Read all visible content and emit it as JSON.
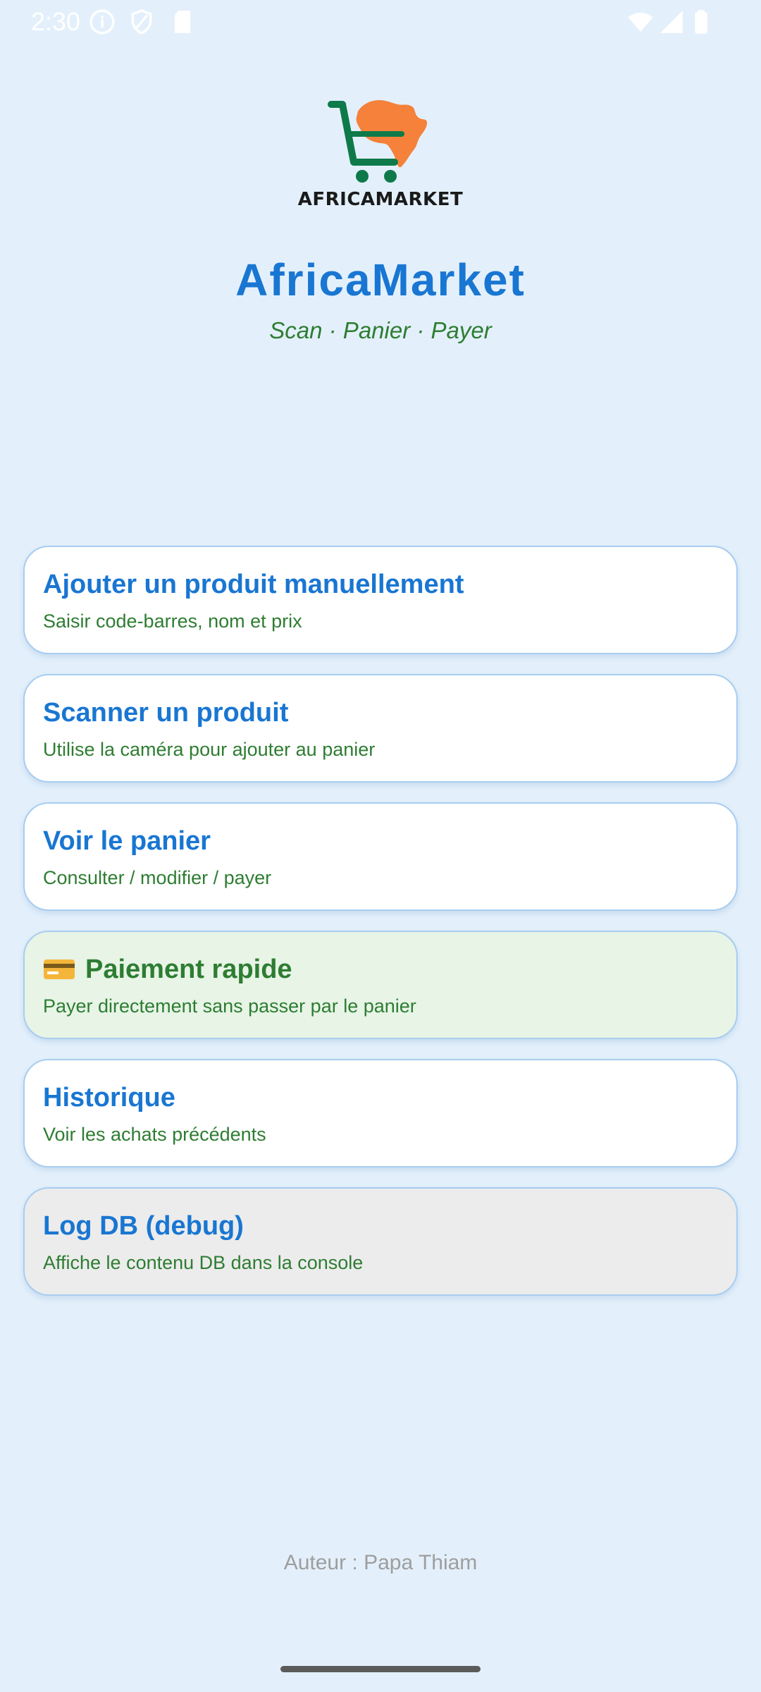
{
  "status_bar": {
    "time": "2:30",
    "left_icons": [
      "info-icon",
      "shield-icon",
      "sd-card-icon"
    ],
    "right_icons": [
      "wifi-icon",
      "signal-icon",
      "battery-icon"
    ]
  },
  "logo": {
    "text": "AFRICAMARKET",
    "colors": {
      "cart": "#0e7a4a",
      "africa": "#f5813a"
    }
  },
  "header": {
    "title": "AfricaMarket",
    "subtitle": "Scan · Panier · Payer"
  },
  "menu": {
    "items": [
      {
        "title": "Ajouter un produit manuellement",
        "subtitle": "Saisir code-barres, nom et prix"
      },
      {
        "title": "Scanner un produit",
        "subtitle": "Utilise la caméra pour ajouter au panier"
      },
      {
        "title": "Voir le panier",
        "subtitle": "Consulter / modifier / payer"
      },
      {
        "title": "Paiement rapide",
        "subtitle": "Payer directement sans passer par le panier",
        "icon": "credit-card-icon"
      },
      {
        "title": "Historique",
        "subtitle": "Voir les achats précédents"
      },
      {
        "title": "Log DB (debug)",
        "subtitle": "Affiche le contenu DB dans la console"
      }
    ]
  },
  "footer": {
    "author": "Auteur : Papa Thiam"
  },
  "colors": {
    "background": "#e3f0fb",
    "primary": "#1976d2",
    "accent_green": "#2e7d32",
    "green_card": "#e7f4e6",
    "grey_card": "#ececec"
  }
}
